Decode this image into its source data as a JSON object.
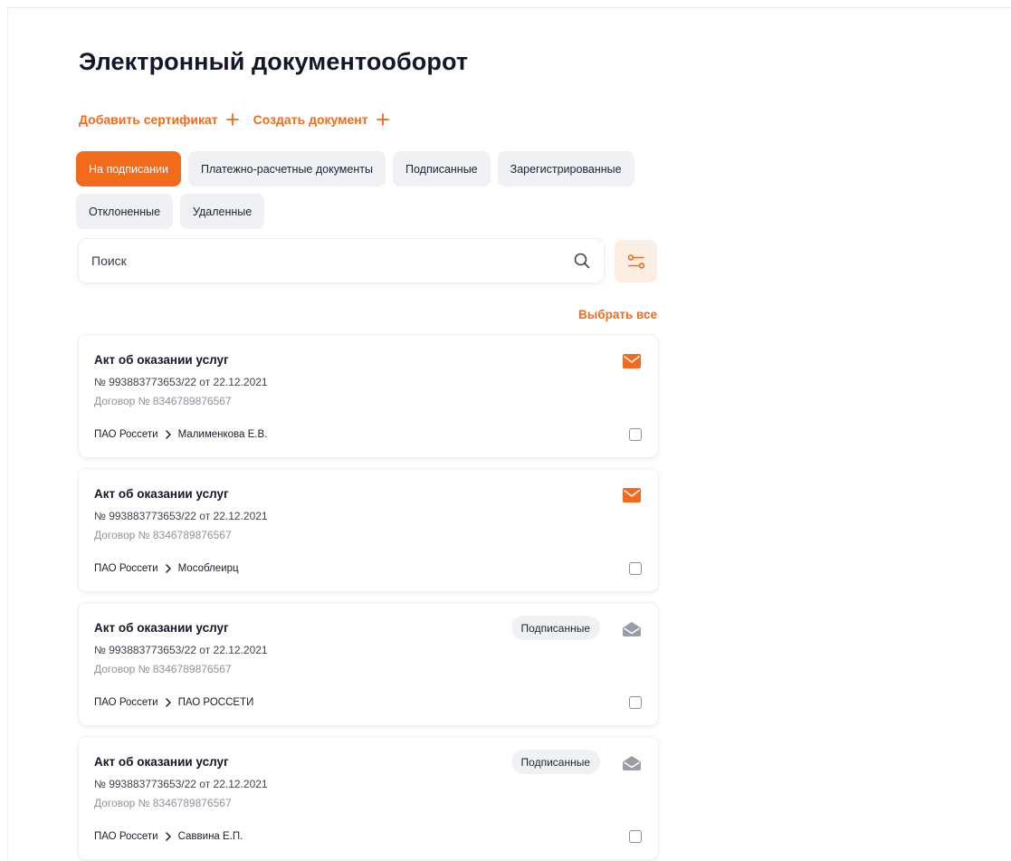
{
  "page": {
    "title": "Электронный документооборот"
  },
  "actions": [
    {
      "label": "Добавить сертификат",
      "icon": "plus-icon"
    },
    {
      "label": "Создать документ",
      "icon": "plus-icon"
    }
  ],
  "tabs": [
    {
      "label": "На подписании",
      "active": true
    },
    {
      "label": "Платежно-расчетные документы",
      "active": false
    },
    {
      "label": "Подписанные",
      "active": false
    },
    {
      "label": "Зарегистрированные",
      "active": false
    },
    {
      "label": "Отклоненные",
      "active": false
    },
    {
      "label": "Удаленные",
      "active": false
    }
  ],
  "search": {
    "placeholder": "Поиск",
    "icon": "search-icon"
  },
  "filter": {
    "icon": "filter-icon"
  },
  "select_all_label": "Выбрать все",
  "colors": {
    "accent": "#f26a1b",
    "accent_light": "#fdeee3",
    "tab_bg": "#eff1f5",
    "envelope_read": "#9a9da6"
  },
  "documents": [
    {
      "title": "Акт об оказании услуг",
      "number": "№ 993883773653/22 от 22.12.2021",
      "contract": "Договор № 8346789876567",
      "from": "ПАО Россети",
      "to": "Малименкова Е.В.",
      "status": "",
      "envelope": "envelope-unread-icon"
    },
    {
      "title": "Акт об оказании услуг",
      "number": "№ 993883773653/22 от 22.12.2021",
      "contract": "Договор № 8346789876567",
      "from": "ПАО Россети",
      "to": "Мособлеирц",
      "status": "",
      "envelope": "envelope-unread-icon"
    },
    {
      "title": "Акт об оказании услуг",
      "number": "№ 993883773653/22 от 22.12.2021",
      "contract": "Договор № 8346789876567",
      "from": "ПАО Россети",
      "to": "ПАО РОССЕТИ",
      "status": "Подписанные",
      "envelope": "envelope-read-icon"
    },
    {
      "title": "Акт об оказании услуг",
      "number": "№ 993883773653/22 от 22.12.2021",
      "contract": "Договор № 8346789876567",
      "from": "ПАО Россети",
      "to": "Саввина Е.П.",
      "status": "Подписанные",
      "envelope": "envelope-read-icon"
    }
  ]
}
